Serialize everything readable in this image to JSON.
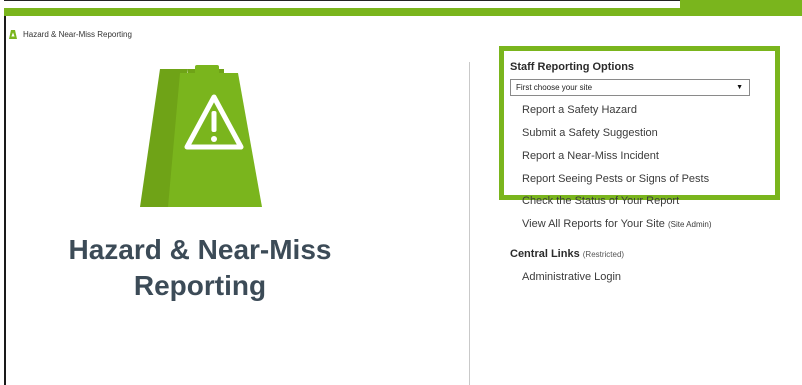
{
  "breadcrumb": {
    "label": "Hazard & Near-Miss Reporting",
    "icon": "wet-floor-sign-icon"
  },
  "hero": {
    "title_line1": "Hazard & Near-Miss",
    "title_line2": "Reporting",
    "icon": "caution-sign-icon"
  },
  "colors": {
    "accent": "#7ab51d",
    "title_text": "#3c4b57"
  },
  "staff_options": {
    "heading": "Staff Reporting Options",
    "site_select": {
      "selected": "First choose your site",
      "arrow": "▼"
    },
    "links": [
      "Report a Safety Hazard",
      "Submit a Safety Suggestion",
      "Report a Near-Miss Incident",
      "Report Seeing Pests or Signs of Pests",
      "Check the Status of Your Report"
    ],
    "view_all": {
      "label": "View All Reports for Your Site",
      "note": "(Site Admin)"
    }
  },
  "central_links": {
    "heading": "Central Links",
    "note": "(Restricted)",
    "items": [
      "Administrative Login"
    ]
  }
}
